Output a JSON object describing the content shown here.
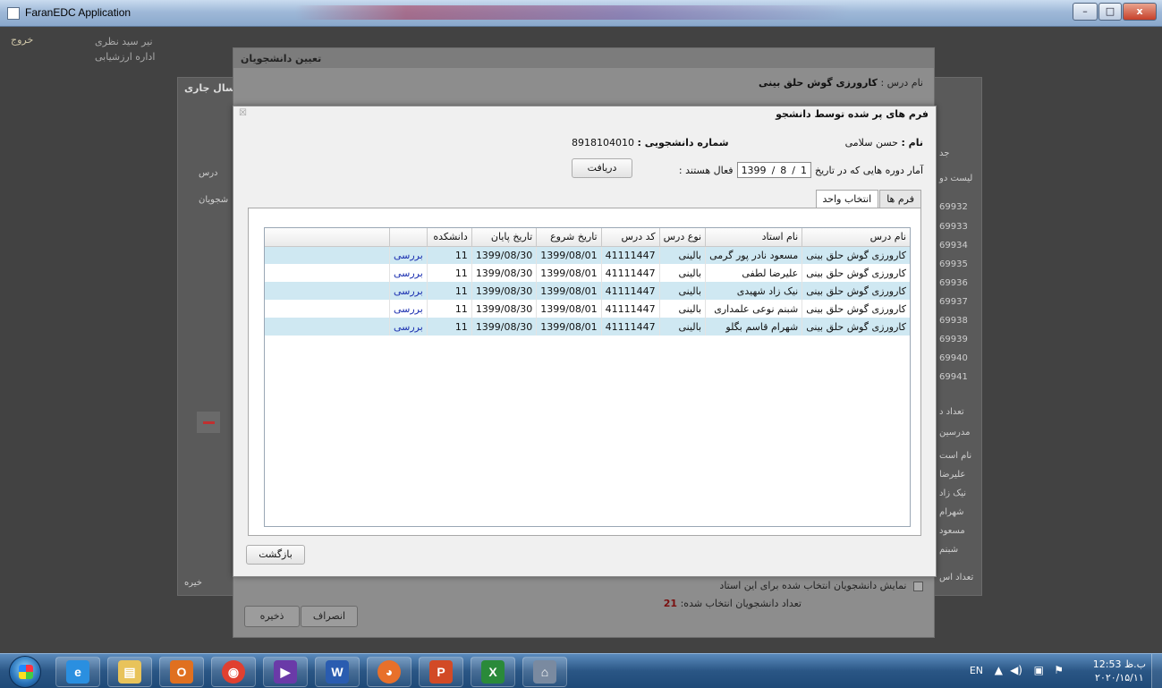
{
  "window": {
    "title": "FaranEDC Application",
    "minimize": "–",
    "maximize": "□",
    "close": "x"
  },
  "background": {
    "corner_tag": "خروج",
    "user_line1": "نیر سید نظری",
    "user_line2": "اداره ارزشیابی",
    "panel_title": "سال جاری",
    "left_labels": [
      "درس",
      "شجویان"
    ],
    "id_list": [
      "69932",
      "69933",
      "69934",
      "69935",
      "69936",
      "69937",
      "69938",
      "69939",
      "69940",
      "69941"
    ],
    "right_labels": [
      "جد",
      "لیست دو",
      "تعداد د",
      "مدرسین",
      "نام است",
      "علیرضا",
      "نیک زاد",
      "شهرام",
      "مسعود",
      "شبنم",
      "تعداد اس"
    ],
    "bottom_left": "خیره"
  },
  "assign_window": {
    "title": "تعیین دانشجویان",
    "course_label": "نام درس :",
    "course_value": "کارورزی گوش حلق بینی",
    "show_selected_label": "نمایش دانشجویان انتخاب شده برای این استاد",
    "selected_count_label": "تعداد دانشجویان انتخاب شده:",
    "selected_count_value": "21",
    "cancel_label": "انصراف",
    "save_label": "ذخیره"
  },
  "modal": {
    "title": "فرم های پر شده توسط دانشجو",
    "close": "☒",
    "name_label": "نام :",
    "name_value": "حسن سلامی",
    "student_no_label": "شماره دانشجویی :",
    "student_no_value": "8918104010",
    "stats_label": "آمار دوره هایی که در تاریخ",
    "date": {
      "year": "1399",
      "month": "8",
      "day": "1"
    },
    "active_label": "فعال هستند :",
    "fetch_label": "دریافت",
    "tabs": [
      "فرم ها",
      "انتخاب واحد"
    ],
    "active_tab": "انتخاب واحد",
    "back_label": "بازگشت"
  },
  "table": {
    "columns": [
      "نام درس",
      "نام استاد",
      "نوع درس",
      "کد درس",
      "تاریخ شروع",
      "تاریخ پایان",
      "دانشکده",
      ""
    ],
    "rows": [
      [
        "کارورزی گوش حلق بینی",
        "مسعود نادر پور گرمی",
        "بالینی",
        "41111447",
        "1399/08/01",
        "1399/08/30",
        "11",
        "بررسی"
      ],
      [
        "کارورزی گوش حلق بینی",
        "علیرضا لطفی",
        "بالینی",
        "41111447",
        "1399/08/01",
        "1399/08/30",
        "11",
        "بررسی"
      ],
      [
        "کارورزی گوش حلق بینی",
        "نیک زاد شهیدی",
        "بالینی",
        "41111447",
        "1399/08/01",
        "1399/08/30",
        "11",
        "بررسی"
      ],
      [
        "کارورزی گوش حلق بینی",
        "شبنم نوعی علمداری",
        "بالینی",
        "41111447",
        "1399/08/01",
        "1399/08/30",
        "11",
        "بررسی"
      ],
      [
        "کارورزی گوش حلق بینی",
        "شهرام قاسم بگلو",
        "بالینی",
        "41111447",
        "1399/08/01",
        "1399/08/30",
        "11",
        "بررسی"
      ]
    ]
  },
  "taskbar": {
    "apps": [
      {
        "name": "ie-icon",
        "glyph": "e",
        "color": "#2a8fe0"
      },
      {
        "name": "file-explorer-icon",
        "glyph": "▤",
        "color": "#e8c35a"
      },
      {
        "name": "outlook-icon",
        "glyph": "O",
        "color": "#e07020"
      },
      {
        "name": "chrome-icon",
        "glyph": "◉",
        "color": "#e04030"
      },
      {
        "name": "media-player-icon",
        "glyph": "▶",
        "color": "#6a3aa8"
      },
      {
        "name": "word-icon",
        "glyph": "W",
        "color": "#2a5cb0"
      },
      {
        "name": "firefox-icon",
        "glyph": "◕",
        "color": "#e8702a"
      },
      {
        "name": "powerpoint-icon",
        "glyph": "P",
        "color": "#d24a26"
      },
      {
        "name": "excel-icon",
        "glyph": "X",
        "color": "#2a8a3a"
      },
      {
        "name": "faranedc-icon",
        "glyph": "⌂",
        "color": "#7a8aa0"
      }
    ],
    "lang": "EN",
    "time": "12:53 ب.ظ",
    "date": "۲۰۲۰/۱۵/۱۱"
  }
}
